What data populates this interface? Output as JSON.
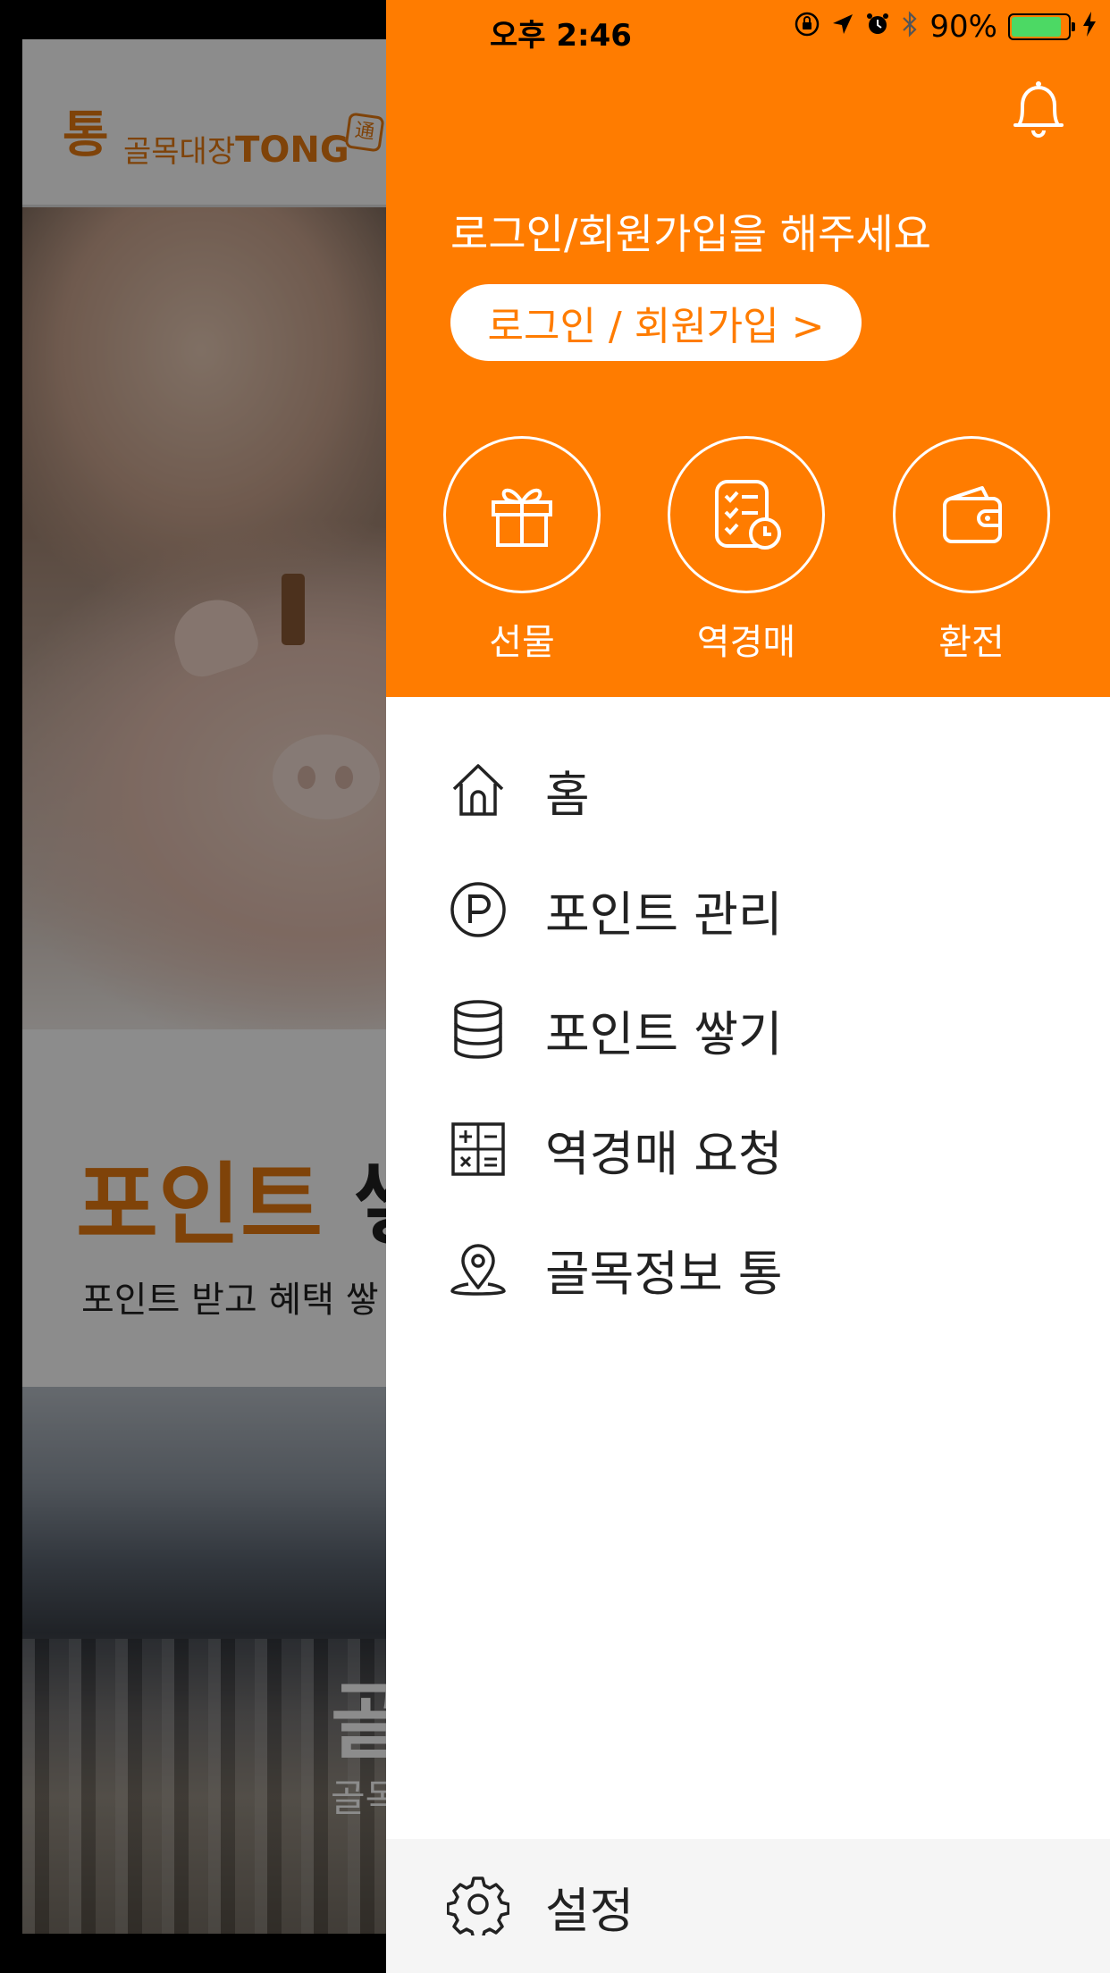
{
  "status_bar": {
    "time": "오후 2:46",
    "battery": "90%",
    "battery_level": 0.9,
    "icons": [
      "rotation-lock-icon",
      "location-icon",
      "alarm-icon",
      "bluetooth-icon",
      "battery-icon",
      "charging-icon"
    ]
  },
  "background": {
    "logo_mark": "통",
    "logo_name": "골목대장",
    "logo_brand": "TONG",
    "logo_seal": "通",
    "headline_orange": "포인트",
    "headline_dark": " 쌓",
    "subline": "포인트 받고 혜택 쌓",
    "banner2_title": "골",
    "banner2_sub": "골목"
  },
  "drawer": {
    "login_prompt": "로그인/회원가입을 해주세요",
    "login_button": "로그인 / 회원가입 >",
    "quick_actions": [
      {
        "label": "선물",
        "icon": "gift-icon"
      },
      {
        "label": "역경매",
        "icon": "checklist-clock-icon"
      },
      {
        "label": "환전",
        "icon": "wallet-icon"
      }
    ],
    "menu": [
      {
        "label": "홈",
        "icon": "home-icon"
      },
      {
        "label": "포인트 관리",
        "icon": "point-p-icon"
      },
      {
        "label": "포인트 쌓기",
        "icon": "database-stack-icon"
      },
      {
        "label": "역경매 요청",
        "icon": "calculator-icon"
      },
      {
        "label": "골목정보 통",
        "icon": "location-pin-icon"
      }
    ],
    "settings_label": "설정",
    "colors": {
      "accent": "#ff7c00",
      "settings_bg": "#f5f5f5",
      "text": "#222222"
    }
  }
}
